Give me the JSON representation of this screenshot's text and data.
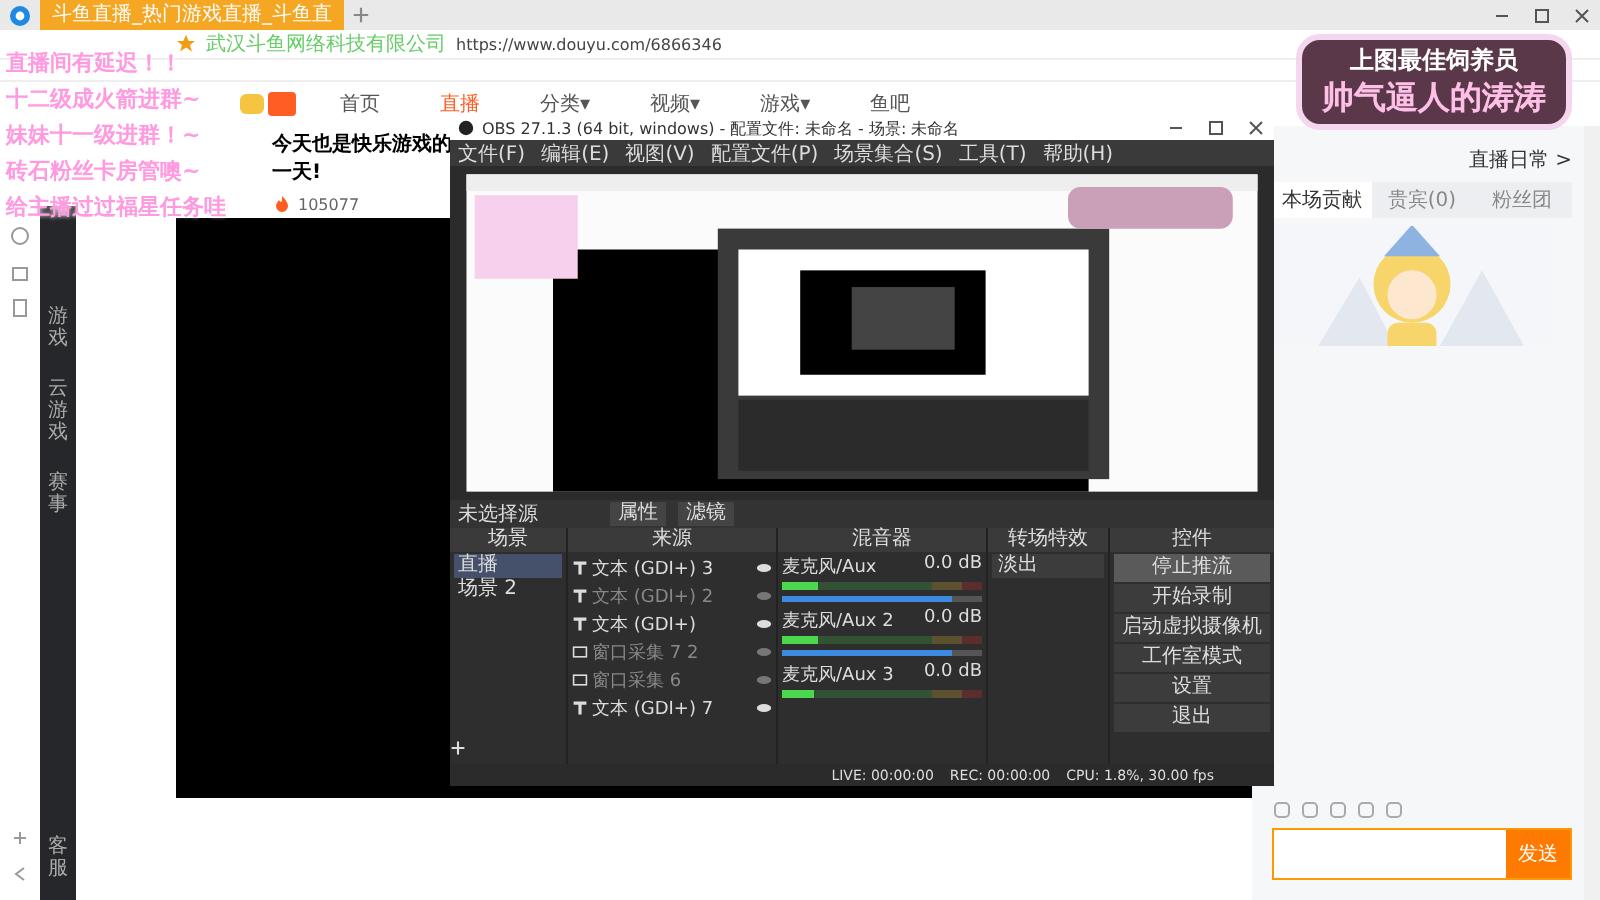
{
  "browser": {
    "tab_title": "斗鱼直播_热门游戏直播_斗鱼直",
    "address_owner": "武汉斗鱼网络科技有限公司",
    "url": "https://www.douyu.com/6866346"
  },
  "site_nav": [
    {
      "label": "首页",
      "selected": false
    },
    {
      "label": "直播",
      "selected": true
    },
    {
      "label": "分类▾",
      "selected": false
    },
    {
      "label": "视频▾",
      "selected": false
    },
    {
      "label": "游戏▾",
      "selected": false
    },
    {
      "label": "鱼吧",
      "selected": false
    }
  ],
  "sidebar": {
    "items": [
      "游戏",
      "云游戏",
      "赛事"
    ],
    "footer": "客服"
  },
  "room": {
    "title": "今天也是快乐游戏的一天!",
    "heat": "105077"
  },
  "overlay_notes": [
    "直播间有延迟！！",
    "十二级成火箭进群~",
    "妹妹十一级进群！~",
    "砖石粉丝卡房管噢~",
    "给主播过过福星任务哇"
  ],
  "overlay_badge": {
    "line1": "上图最佳饲养员",
    "line2": "帅气逼人的涛涛"
  },
  "right_panel": {
    "link": "直播日常 >",
    "tabs": [
      {
        "label": "本场贡献",
        "selected": true
      },
      {
        "label": "贵宾(0)",
        "selected": false
      },
      {
        "label": "粉丝团",
        "selected": false
      }
    ],
    "send_button": "发送"
  },
  "obs": {
    "title": "OBS 27.1.3 (64 bit, windows) - 配置文件: 未命名 - 场景: 未命名",
    "menu": [
      "文件(F)",
      "编辑(E)",
      "视图(V)",
      "配置文件(P)",
      "场景集合(S)",
      "工具(T)",
      "帮助(H)"
    ],
    "source_bar": {
      "label": "未选择源",
      "buttons": [
        "属性",
        "滤镜"
      ]
    },
    "scenes": {
      "title": "场景",
      "items": [
        {
          "label": "直播",
          "selected": true
        },
        {
          "label": "场景 2",
          "selected": false
        }
      ]
    },
    "sources": {
      "title": "来源",
      "items": [
        {
          "label": "文本 (GDI+) 3",
          "kind": "text",
          "visible": true
        },
        {
          "label": "文本 (GDI+) 2",
          "kind": "text",
          "visible": false
        },
        {
          "label": "文本 (GDI+)",
          "kind": "text",
          "visible": true
        },
        {
          "label": "窗口采集 7 2",
          "kind": "window",
          "visible": false
        },
        {
          "label": "窗口采集 6",
          "kind": "window",
          "visible": false
        },
        {
          "label": "文本 (GDI+) 7",
          "kind": "text",
          "visible": true
        }
      ]
    },
    "mixer": {
      "title": "混音器",
      "channels": [
        {
          "name": "麦克风/Aux",
          "reading": "0.0 dB",
          "meter": {
            "level": 0.18
          },
          "fader": {
            "level": 0.85
          }
        },
        {
          "name": "麦克风/Aux 2",
          "reading": "0.0 dB",
          "meter": {
            "level": 0.18
          },
          "fader": {
            "level": 0.85
          }
        },
        {
          "name": "麦克风/Aux 3",
          "reading": "0.0 dB",
          "meter": {
            "level": 0.16
          }
        }
      ]
    },
    "transitions": {
      "title": "转场特效",
      "current": "淡出"
    },
    "controls": {
      "title": "控件",
      "buttons": [
        {
          "label": "停止推流",
          "active": true
        },
        {
          "label": "开始录制",
          "active": false
        },
        {
          "label": "启动虚拟摄像机",
          "active": false
        },
        {
          "label": "工作室模式",
          "active": false
        },
        {
          "label": "设置",
          "active": false
        },
        {
          "label": "退出",
          "active": false
        }
      ]
    },
    "status": [
      "LIVE: 00:00:00",
      "REC: 00:00:00",
      "CPU: 1.8%, 30.00 fps"
    ]
  }
}
